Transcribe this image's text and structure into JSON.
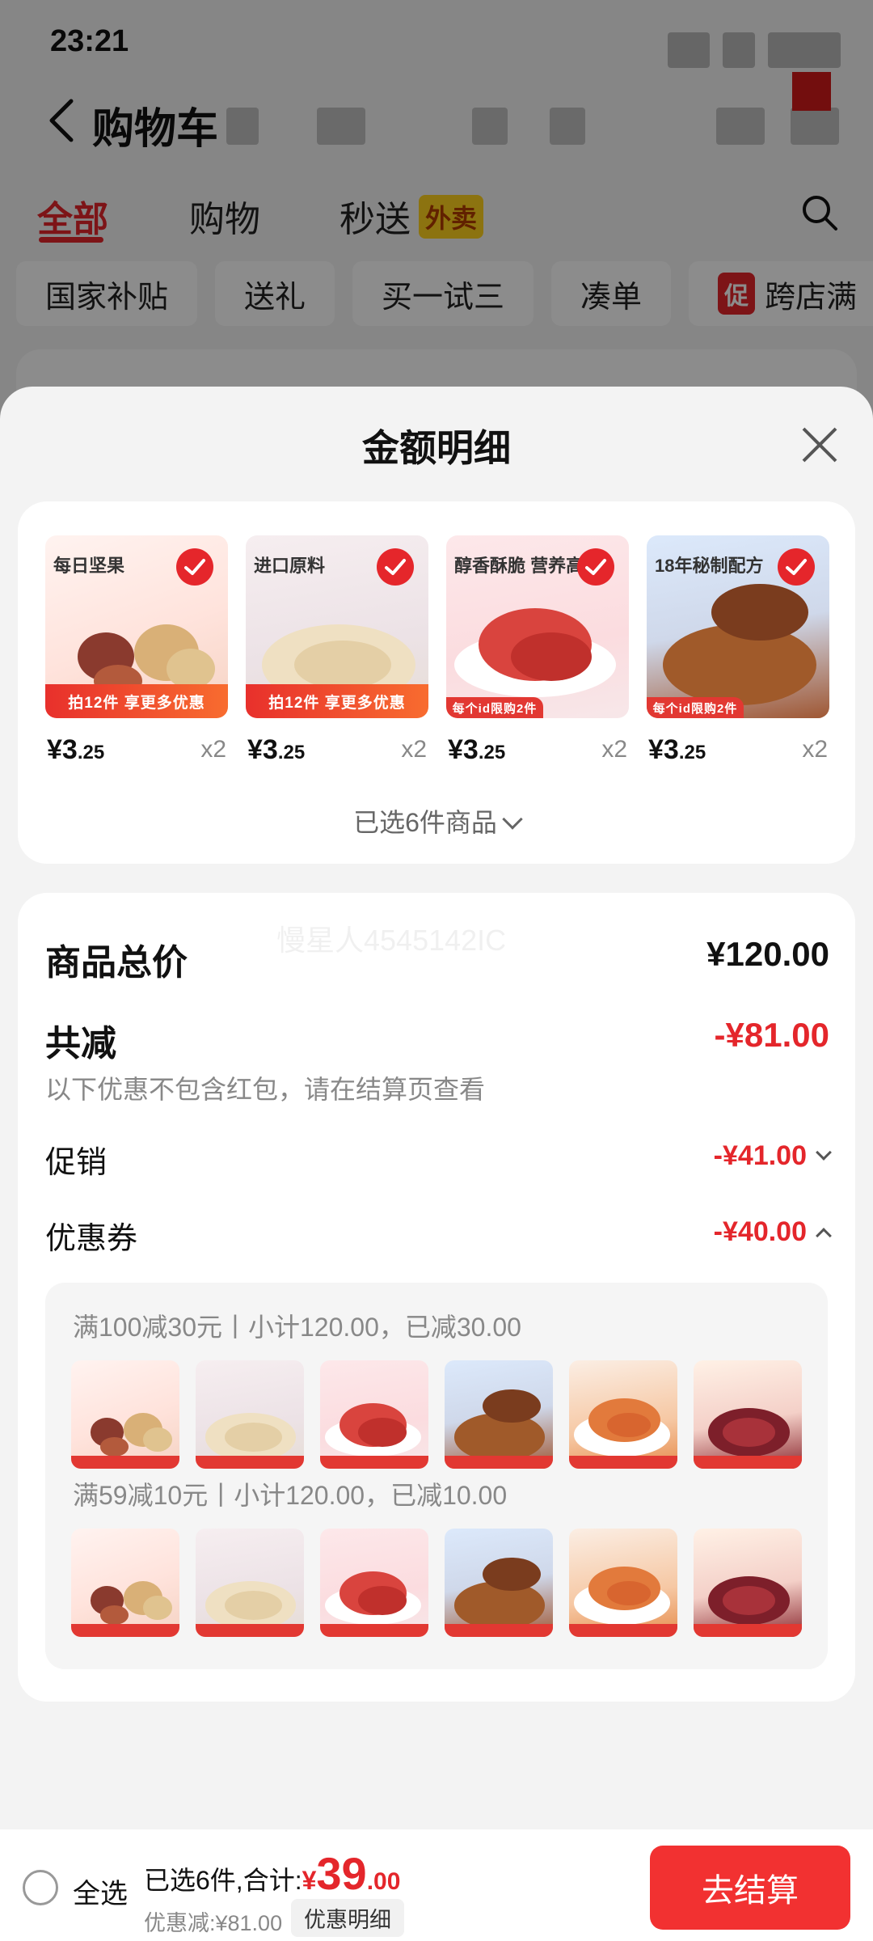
{
  "status_bar": {
    "time": "23:21"
  },
  "header": {
    "title": "购物车"
  },
  "tabs": [
    {
      "label": "全部",
      "active": true
    },
    {
      "label": "购物",
      "active": false
    },
    {
      "label": "秒送",
      "active": false,
      "badge": "外卖"
    }
  ],
  "filter_chips": [
    {
      "label": "国家补贴"
    },
    {
      "label": "送礼"
    },
    {
      "label": "买一试三"
    },
    {
      "label": "凑单"
    },
    {
      "label": "跨店满",
      "promo_mark": "促"
    }
  ],
  "sheet": {
    "title": "金额明细",
    "products": [
      {
        "art": "nuts",
        "label": "每日坚果",
        "banner": "拍12件 享更多优惠",
        "price_int": "¥3",
        "price_dec": ".25",
        "qty": "x2",
        "checked": true
      },
      {
        "art": "cashew",
        "label": "进口原料",
        "banner": "拍12件 享更多优惠",
        "price_int": "¥3",
        "price_dec": ".25",
        "qty": "x2",
        "checked": true
      },
      {
        "art": "jerky",
        "label": "醇香酥脆 营养高",
        "banner": "每个id限购2件",
        "price_int": "¥3",
        "price_dec": ".25",
        "qty": "x2",
        "checked": true
      },
      {
        "art": "fish",
        "label": "18年秘制配方",
        "banner": "每个id限购2件",
        "price_int": "¥3",
        "price_dec": ".25",
        "qty": "x2",
        "checked": true
      }
    ],
    "selected_toggle": "已选6件商品",
    "watermark": "慢星人4545142IC",
    "summary": {
      "total_label": "商品总价",
      "total_value": "¥120.00",
      "reduce_label": "共减",
      "reduce_value": "-¥81.00",
      "note": "以下优惠不包含红包，请在结算页查看",
      "promo_label": "促销",
      "promo_value": "-¥41.00",
      "coupon_label": "优惠券",
      "coupon_value": "-¥40.00"
    },
    "coupons": [
      {
        "text": "满100减30元丨小计120.00，已减30.00",
        "thumbs": [
          "nuts",
          "cashew",
          "jerky",
          "fish",
          "squid",
          "pork"
        ]
      },
      {
        "text": "满59减10元丨小计120.00，已减10.00",
        "thumbs": [
          "nuts",
          "cashew",
          "jerky",
          "fish",
          "squid",
          "pork"
        ]
      }
    ]
  },
  "bottom_bar": {
    "select_all": "全选",
    "selected_sum": "已选6件,合计:",
    "sum_symbol": "¥",
    "sum_int": "39",
    "sum_dec": ".00",
    "discount": "优惠减:¥81.00",
    "detail_button": "优惠明细",
    "checkout": "去结算"
  },
  "colors": {
    "accent": "#e4262b",
    "checkout": "#f23131",
    "badge": "#ffd21e"
  }
}
